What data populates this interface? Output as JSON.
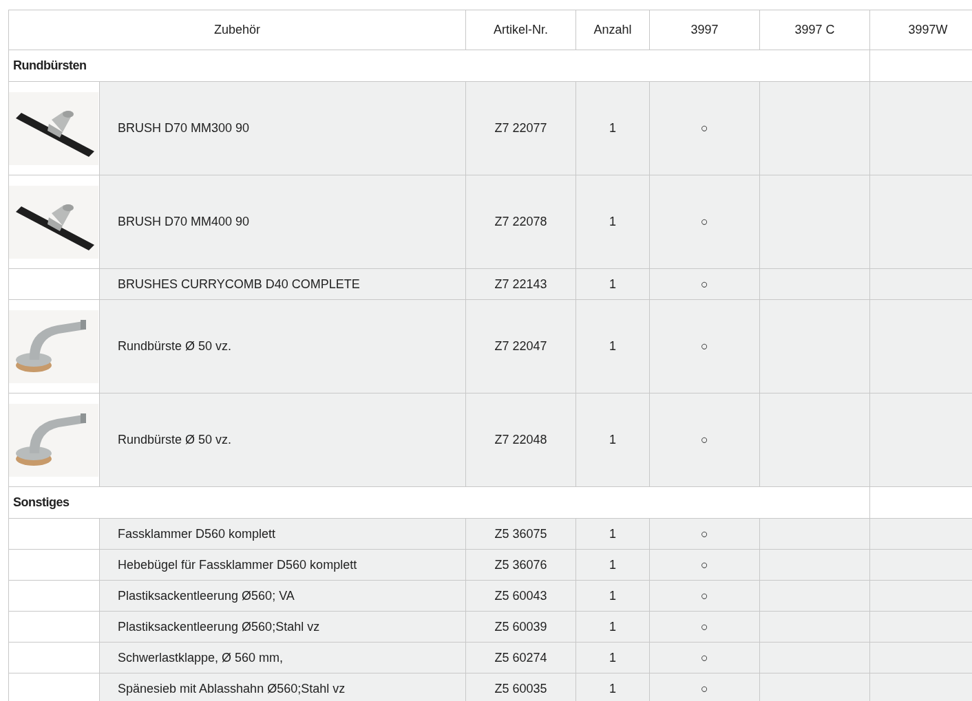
{
  "columns": [
    "Zubehör",
    "Artikel-Nr.",
    "Anzahl",
    "3997",
    "3997 C",
    "3997W"
  ],
  "sections": [
    {
      "title": "Rundbürsten",
      "rows": [
        {
          "image": {
            "kind": "picture"
          },
          "name": "BRUSH D70 MM300 90",
          "article": "Z7 22077",
          "count": "1",
          "marks": [
            "○"
          ]
        },
        {
          "image": {
            "kind": "picture"
          },
          "name": "BRUSH D70 MM400 90",
          "article": "Z7 22078",
          "count": "1",
          "marks": [
            "○"
          ]
        },
        {
          "name": "BRUSHES CURRYCOMB D40 COMPLETE",
          "article": "Z7 22143",
          "count": "1",
          "marks": [
            "○"
          ]
        },
        {
          "image": {
            "kind": "picture"
          },
          "name": "Rundbürste Ø 50  vz.",
          "article": "Z7 22047",
          "count": "1",
          "marks": [
            "○"
          ]
        },
        {
          "image": {
            "kind": "picture"
          },
          "name": "Rundbürste Ø 50  vz.",
          "article": "Z7 22048",
          "count": "1",
          "marks": [
            "○"
          ]
        }
      ]
    },
    {
      "title": "Sonstiges",
      "rows": [
        {
          "name": "Fassklammer D560 komplett",
          "article": "Z5 36075",
          "count": "1",
          "marks": [
            "○"
          ]
        },
        {
          "name": "Hebebügel für Fassklammer D560 komplett",
          "article": "Z5 36076",
          "count": "1",
          "marks": [
            "○"
          ]
        },
        {
          "name": "Plastiksackentleerung Ø560; VA",
          "article": "Z5 60043",
          "count": "1",
          "marks": [
            "○"
          ]
        },
        {
          "name": "Plastiksackentleerung Ø560;Stahl vz",
          "article": "Z5 60039",
          "count": "1",
          "marks": [
            "○"
          ]
        },
        {
          "name": "Schwerlastklappe, Ø 560 mm,",
          "article": "Z5 60274",
          "count": "1",
          "marks": [
            "○"
          ]
        },
        {
          "name": "Spänesieb mit Ablasshahn Ø560;Stahl vz",
          "article": "Z5 60035",
          "count": "1",
          "marks": [
            "○"
          ]
        }
      ]
    }
  ]
}
